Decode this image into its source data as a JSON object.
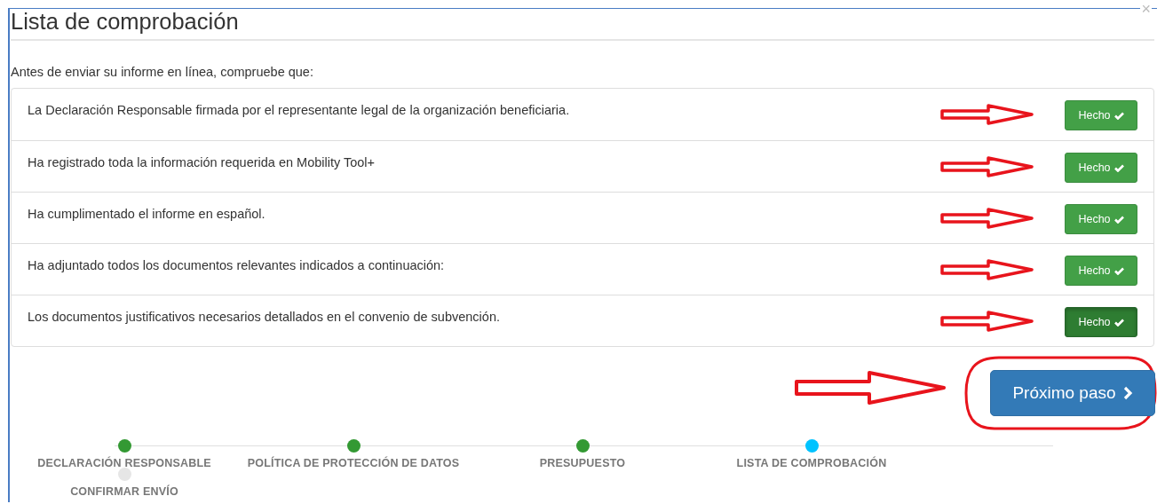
{
  "title": "Lista de comprobación",
  "close": "×",
  "intro": "Antes de enviar su informe en línea, compruebe que:",
  "items": [
    {
      "text": "La Declaración Responsable firmada por el representante legal de la organización beneficiaria.",
      "button": "Hecho",
      "pressed": false
    },
    {
      "text": "Ha registrado toda la información requerida en Mobility Tool+",
      "button": "Hecho",
      "pressed": false
    },
    {
      "text": "Ha cumplimentado el informe en español.",
      "button": "Hecho",
      "pressed": false
    },
    {
      "text": "Ha adjuntado todos los documentos relevantes indicados a continuación:",
      "button": "Hecho",
      "pressed": false
    },
    {
      "text": "Los documentos justificativos necesarios detallados en el convenio de subvención.",
      "button": "Hecho",
      "pressed": true
    }
  ],
  "next_button": "Próximo paso",
  "steps": [
    {
      "label": "DECLARACIÓN RESPONSABLE",
      "completed": true,
      "selected": false
    },
    {
      "label": "POLÍTICA DE PROTECCIÓN DE DATOS",
      "completed": true,
      "selected": false
    },
    {
      "label": "PRESUPUESTO",
      "completed": true,
      "selected": false
    },
    {
      "label": "LISTA DE COMPROBACIÓN",
      "completed": false,
      "selected": true
    },
    {
      "label": "CONFIRMAR ENVÍO",
      "completed": false,
      "selected": false
    }
  ]
}
